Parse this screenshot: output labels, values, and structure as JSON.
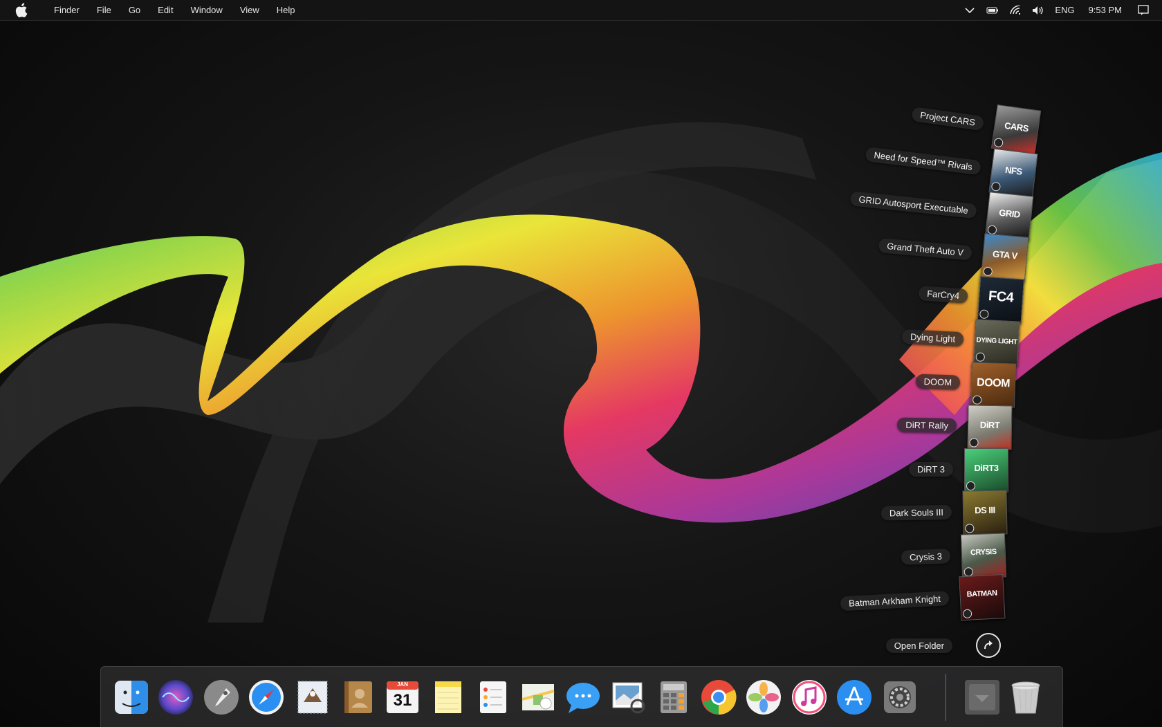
{
  "menubar": {
    "apple_icon": "apple-logo-icon",
    "items": [
      "Finder",
      "File",
      "Go",
      "Edit",
      "Window",
      "View",
      "Help"
    ],
    "right": {
      "input_language": "ENG",
      "time": "9:53 PM",
      "icons": [
        "chevron-down-icon",
        "battery-icon",
        "wifi-icon",
        "volume-icon",
        "notification-center-icon"
      ]
    }
  },
  "stack": {
    "items": [
      {
        "label": "Project CARS",
        "cover_text": "CARS",
        "color": "#7a7a7a"
      },
      {
        "label": "Need for Speed™ Rivals",
        "cover_text": "NFS",
        "color": "#3c5a78"
      },
      {
        "label": "GRID Autosport Executable",
        "cover_text": "GRID",
        "color": "#5a5a5a"
      },
      {
        "label": "Grand Theft Auto V",
        "cover_text": "GTA V",
        "color": "#8a5a2a"
      },
      {
        "label": "FarCry4",
        "cover_text": "FC4",
        "color": "#1e2a36"
      },
      {
        "label": "Dying Light",
        "cover_text": "DYING LIGHT",
        "color": "#3a3a30"
      },
      {
        "label": "DOOM",
        "cover_text": "DOOM",
        "color": "#6a3a1a"
      },
      {
        "label": "DiRT Rally",
        "cover_text": "DiRT",
        "color": "#8a8a80"
      },
      {
        "label": "DiRT 3",
        "cover_text": "DiRT3",
        "color": "#2a6a3a"
      },
      {
        "label": "Dark Souls III",
        "cover_text": "DS III",
        "color": "#5a4a20"
      },
      {
        "label": "Crysis 3",
        "cover_text": "CRYSIS",
        "color": "#4a5a4a"
      },
      {
        "label": "Batman  Arkham Knight",
        "cover_text": "BATMAN",
        "color": "#3a1010"
      }
    ],
    "open_folder": "Open Folder"
  },
  "dock": {
    "apps": [
      {
        "name": "finder-icon",
        "color": "#2f8ee8"
      },
      {
        "name": "siri-icon",
        "color": "#7d5cc9"
      },
      {
        "name": "launchpad-icon",
        "color": "#8a8a8a"
      },
      {
        "name": "safari-icon",
        "color": "#2a8ff0"
      },
      {
        "name": "mail-icon",
        "color": "#c9d6e2"
      },
      {
        "name": "contacts-icon",
        "color": "#b5884a"
      },
      {
        "name": "calendar-icon",
        "color": "#f4f4f4"
      },
      {
        "name": "notes-icon",
        "color": "#f7d94c"
      },
      {
        "name": "reminders-icon",
        "color": "#f4f4f4"
      },
      {
        "name": "maps-icon",
        "color": "#8cc66a"
      },
      {
        "name": "messages-icon",
        "color": "#3aa0f5"
      },
      {
        "name": "preview-icon",
        "color": "#6aa0d0"
      },
      {
        "name": "calculator-icon",
        "color": "#9a9a9a"
      },
      {
        "name": "chrome-icon",
        "color": "#e84a3a"
      },
      {
        "name": "photos-icon",
        "color": "#f0f0f0"
      },
      {
        "name": "itunes-icon",
        "color": "#f0507a"
      },
      {
        "name": "app-store-icon",
        "color": "#2a8ff0"
      },
      {
        "name": "system-preferences-icon",
        "color": "#7a7a7a"
      }
    ],
    "calendar": {
      "month": "JAN",
      "day": "31"
    },
    "stack_icon": "downloads-stack-icon",
    "trash_icon": "trash-icon"
  }
}
